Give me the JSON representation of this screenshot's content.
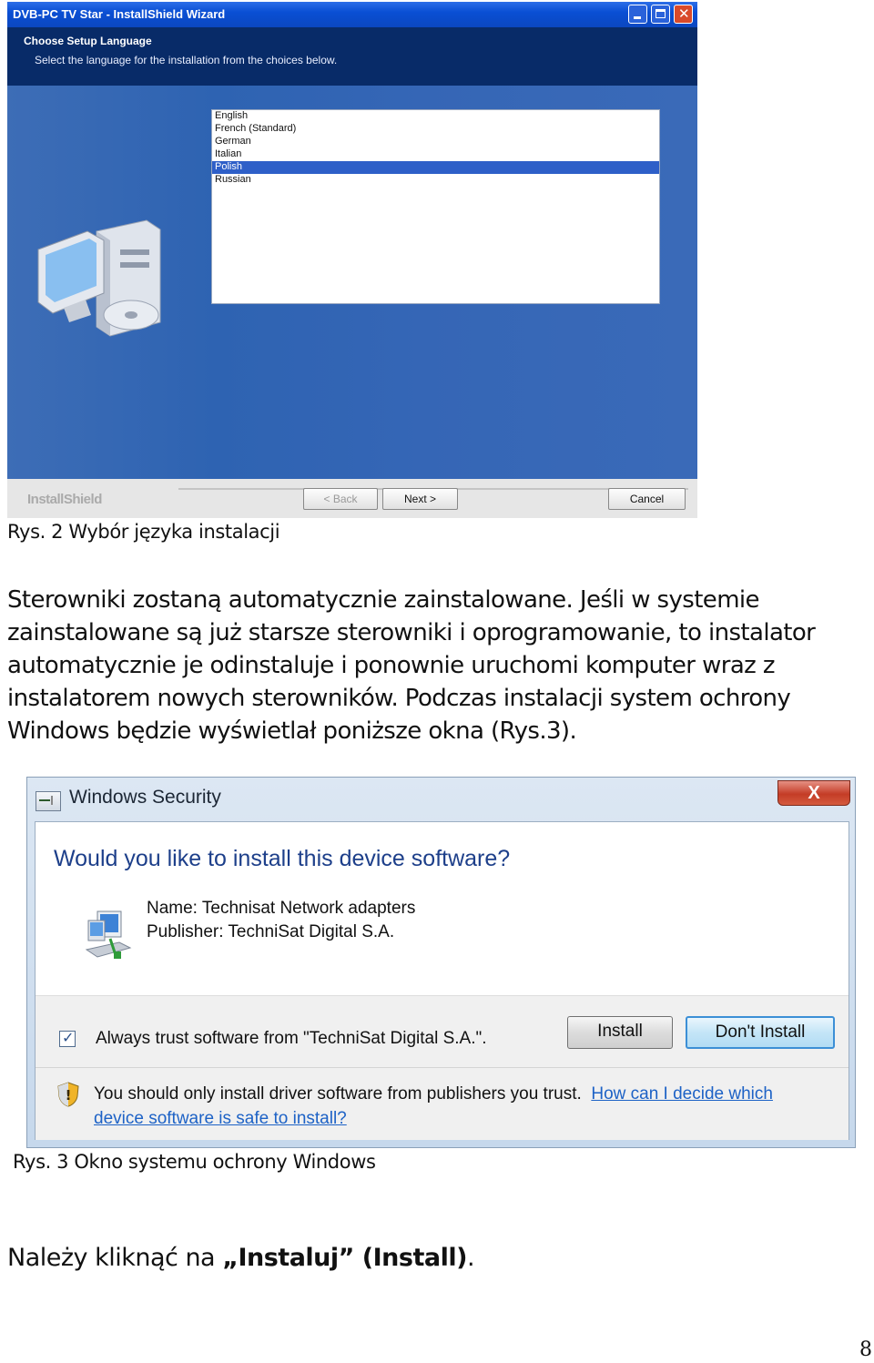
{
  "wizard": {
    "title": "DVB-PC TV Star - InstallShield Wizard",
    "heading": "Choose Setup Language",
    "subheading": "Select the language for the installation from the choices below.",
    "languages": [
      "English",
      "French (Standard)",
      "German",
      "Italian",
      "Polish",
      "Russian"
    ],
    "selected_language": "Polish",
    "brand": "InstallShield",
    "back_label": "< Back",
    "next_label": "Next >",
    "cancel_label": "Cancel"
  },
  "caption1": "Rys. 2 Wybór języka instalacji",
  "paragraph": "Sterowniki zostaną automatycznie zainstalowane. Jeśli w systemie zainstalowane są już starsze sterowniki i oprogramowanie, to instalator automatycznie je odinstaluje i ponownie uruchomi komputer wraz z instalatorem nowych sterowników. Podczas instalacji system ochrony Windows będzie wyświetlał poniższe okna (Rys.3).",
  "security": {
    "title": "Windows Security",
    "close_label": "X",
    "question": "Would you like to install this device software?",
    "name": "Name: Technisat Network adapters",
    "publisher": "Publisher: TechniSat Digital S.A.",
    "checkbox_checked": true,
    "trust_label": "Always trust software from \"TechniSat Digital S.A.\".",
    "install_label": "Install",
    "dont_install_label": "Don't Install",
    "warning_text": "You should only install driver software from publishers you trust.",
    "help_link": "How can I decide which device software is safe to install?"
  },
  "caption2": "Rys. 3 Okno systemu ochrony Windows",
  "final": {
    "prefix": "Należy kliknąć na ",
    "bold": "„Instaluj” (Install)",
    "suffix": "."
  },
  "page_number": "8"
}
